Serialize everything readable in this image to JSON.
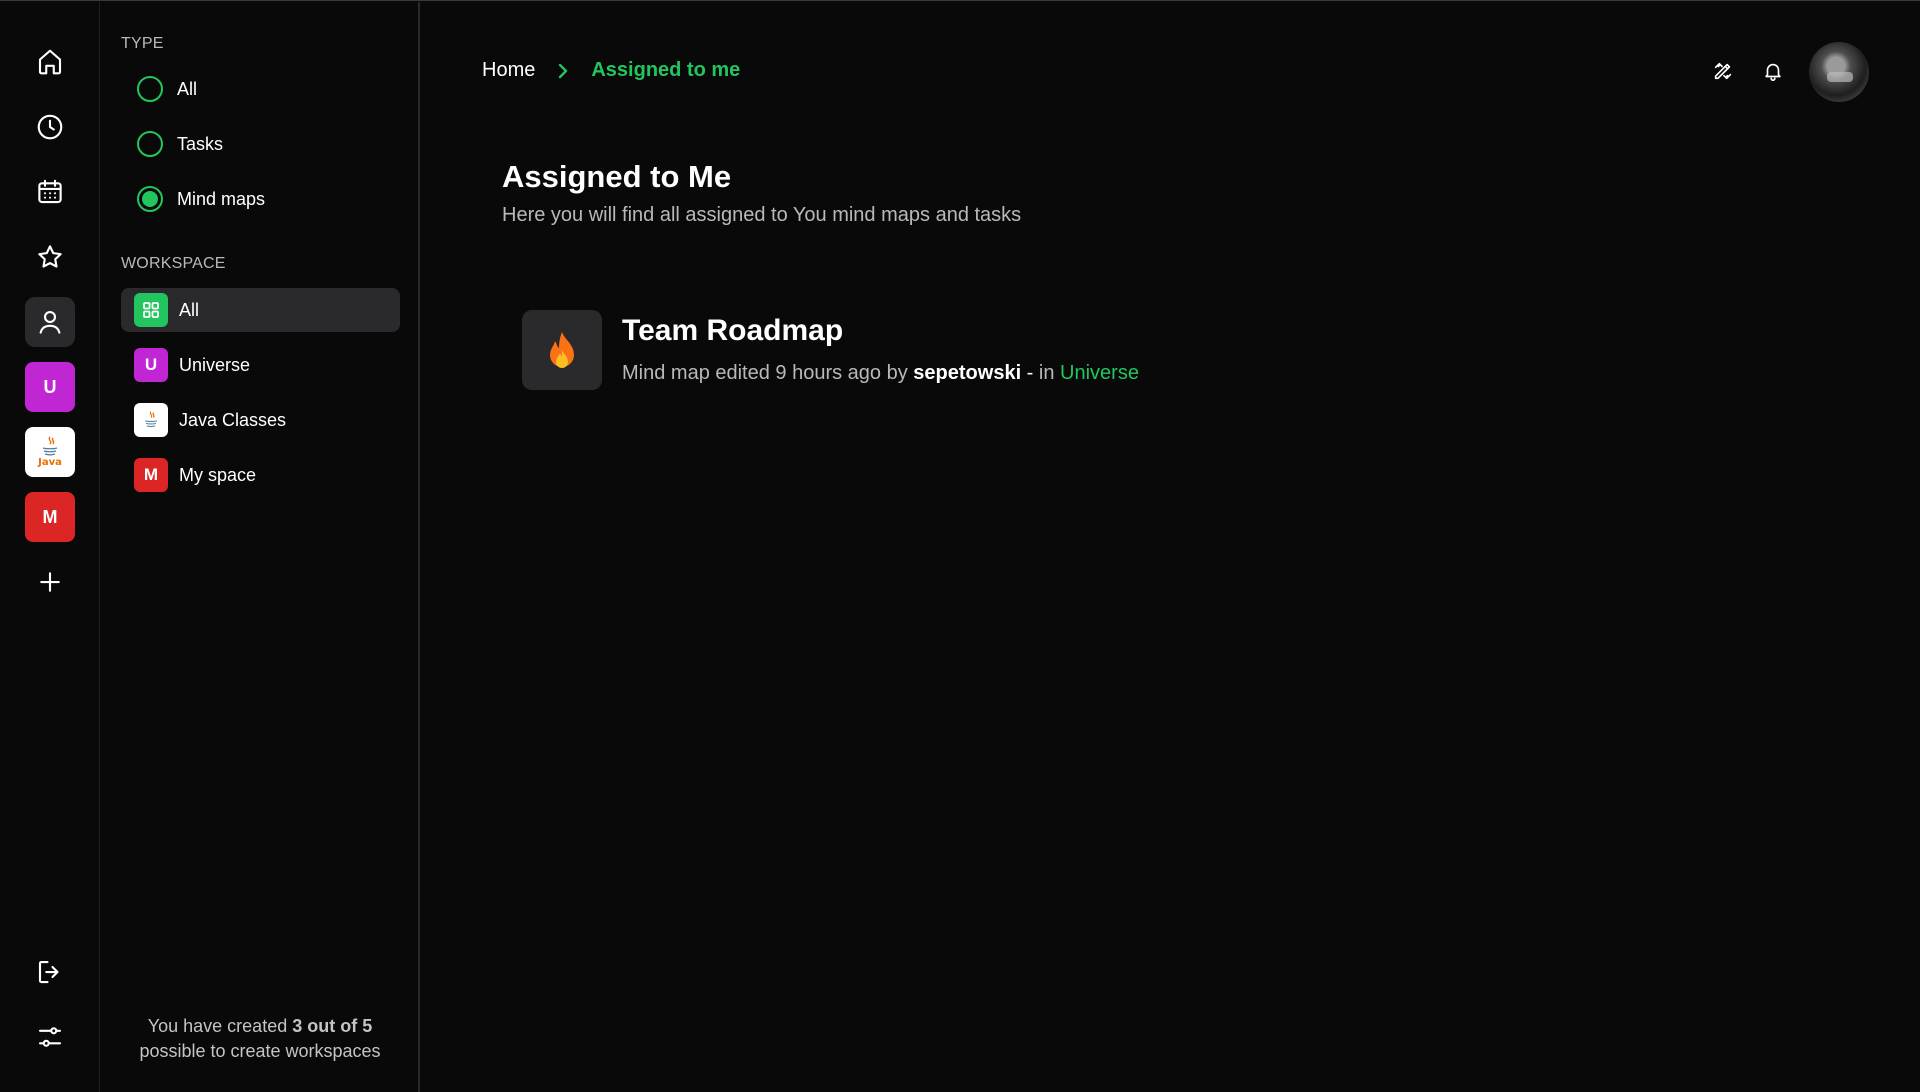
{
  "colors": {
    "accent": "#22c55e",
    "background": "#0a0909",
    "universe_badge": "#c026d3",
    "myspace_badge": "#dc2626",
    "all_badge": "#22c55e"
  },
  "rail": {
    "items": [
      "home-icon",
      "clock-icon",
      "calendar-icon",
      "star-icon",
      "user-icon"
    ],
    "workspaces": [
      {
        "letter": "U",
        "name": "Universe"
      },
      {
        "letter": "Java",
        "name": "Java Classes"
      },
      {
        "letter": "M",
        "name": "My space"
      }
    ],
    "bottom": [
      "logout-icon",
      "settings-icon"
    ]
  },
  "filters": {
    "type_title": "TYPE",
    "types": [
      {
        "label": "All",
        "selected": false
      },
      {
        "label": "Tasks",
        "selected": false
      },
      {
        "label": "Mind maps",
        "selected": true
      }
    ],
    "workspace_title": "WORKSPACE",
    "workspaces": [
      {
        "label": "All",
        "badge": "grid-icon",
        "active": true
      },
      {
        "label": "Universe",
        "badge": "U",
        "active": false
      },
      {
        "label": "Java Classes",
        "badge": "java-logo",
        "active": false
      },
      {
        "label": "My space",
        "badge": "M",
        "active": false
      }
    ],
    "footer": {
      "prefix": "You have created ",
      "count": "3 out of 5",
      "suffix": "possible to create workspaces"
    }
  },
  "breadcrumb": {
    "home": "Home",
    "current": "Assigned to me"
  },
  "header_icons": [
    "pencil-ruler-icon",
    "bell-icon",
    "avatar"
  ],
  "main": {
    "title": "Assigned to Me",
    "subtitle": "Here you will find all assigned to You mind maps and tasks",
    "items": [
      {
        "icon": "fire-icon",
        "title": "Team Roadmap",
        "meta_prefix": "Mind map edited 9 hours ago by ",
        "author": "sepetowski",
        "meta_sep": " - ",
        "meta_in": "in ",
        "workspace": "Universe"
      }
    ]
  }
}
